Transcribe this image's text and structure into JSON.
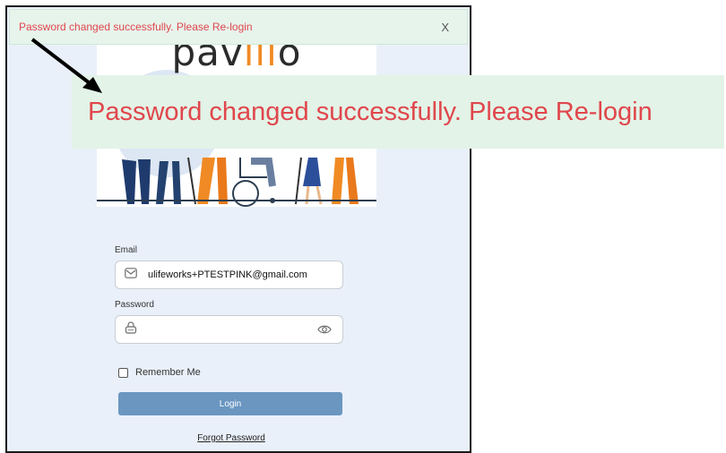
{
  "toast": {
    "message": "Password changed successfully. Please Re-login",
    "close_label": "X"
  },
  "zoom_callout": {
    "text": "Password changed successfully. Please Re-login"
  },
  "brand": {
    "logo_text": "pavilio"
  },
  "form": {
    "email_label": "Email",
    "email_value": "ulifeworks+PTESTPINK@gmail.com",
    "password_label": "Password",
    "password_value": "",
    "remember_label": "Remember Me",
    "login_label": "Login",
    "forgot_label": "Forgot Password"
  },
  "colors": {
    "toast_bg": "#e7f4ec",
    "toast_text": "#e0464c",
    "login_button": "#6a96c0",
    "page_bg": "#e9f0f9"
  },
  "icons": [
    "mail-icon",
    "lock-icon",
    "eye-icon",
    "close-icon",
    "arrow-annotation"
  ]
}
